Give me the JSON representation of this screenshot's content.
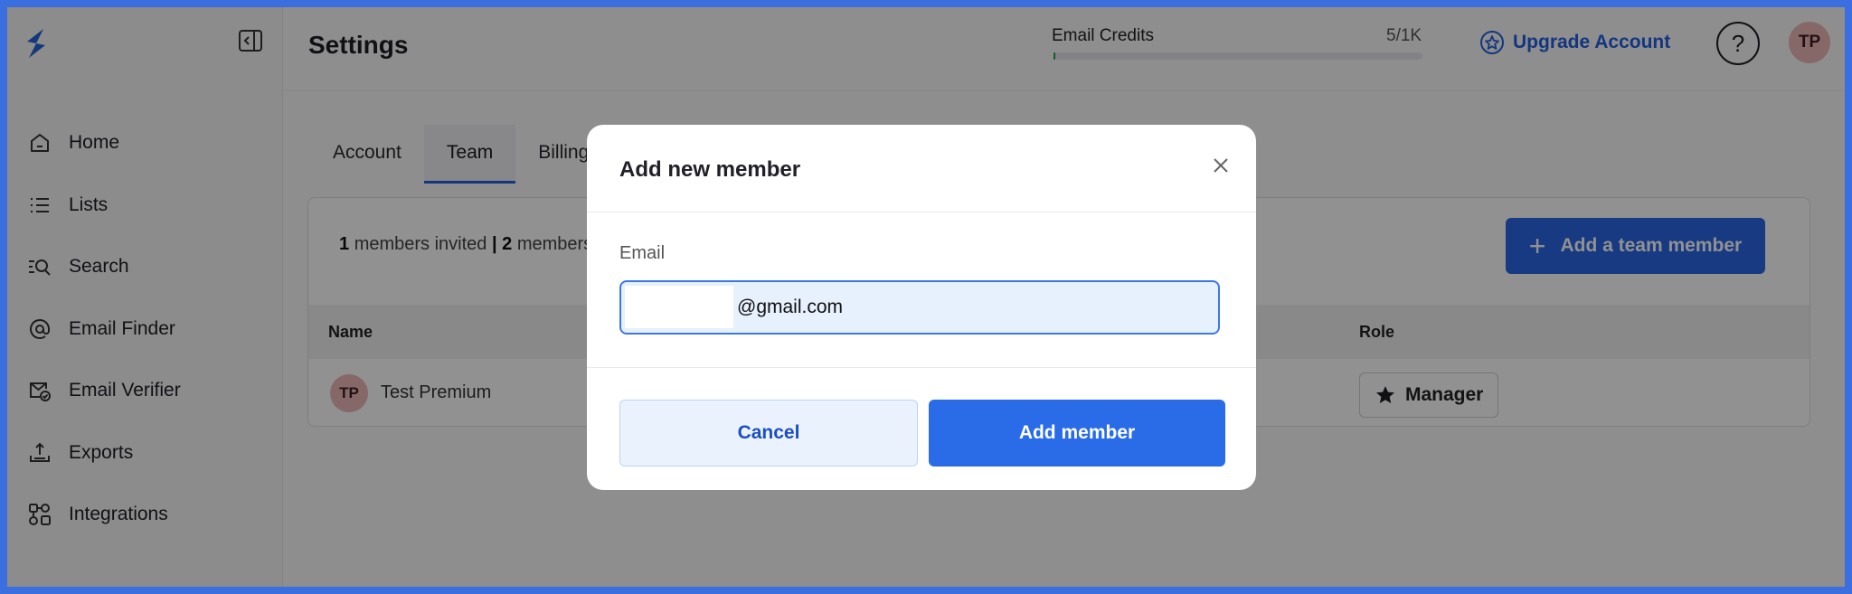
{
  "sidebar": {
    "logo_icon": "brand-logo-icon",
    "collapse_icon": "sidebar-collapse-icon",
    "items": [
      {
        "label": "Home",
        "icon": "home-icon"
      },
      {
        "label": "Lists",
        "icon": "list-icon"
      },
      {
        "label": "Search",
        "icon": "search-list-icon"
      },
      {
        "label": "Email Finder",
        "icon": "at-sign-icon"
      },
      {
        "label": "Email Verifier",
        "icon": "mail-check-icon"
      },
      {
        "label": "Exports",
        "icon": "export-icon"
      },
      {
        "label": "Integrations",
        "icon": "integrations-icon"
      }
    ]
  },
  "header": {
    "title": "Settings",
    "credits_label": "Email Credits",
    "credits_value": "5/1K",
    "credits_used_fraction": 0.005,
    "upgrade_label": "Upgrade Account",
    "help_label": "?",
    "avatar_initials": "TP"
  },
  "tabs": [
    {
      "label": "Account",
      "active": false
    },
    {
      "label": "Team",
      "active": true
    },
    {
      "label": "Billing",
      "active": false
    }
  ],
  "team": {
    "invited_count": "1",
    "invited_text": "members invited",
    "separator": "|",
    "members_count": "2",
    "members_text": "members",
    "add_button_label": "Add a team member",
    "columns": {
      "name": "Name",
      "role": "Role"
    },
    "rows": [
      {
        "initials": "TP",
        "name": "Test Premium",
        "role": "Manager"
      }
    ]
  },
  "modal": {
    "title": "Add new member",
    "email_label": "Email",
    "email_value": "@gmail.com",
    "cancel_label": "Cancel",
    "submit_label": "Add member"
  },
  "colors": {
    "accent": "#2a6ce7",
    "avatar_bg": "#eeb7b7",
    "credits_bar": "#22a060"
  }
}
